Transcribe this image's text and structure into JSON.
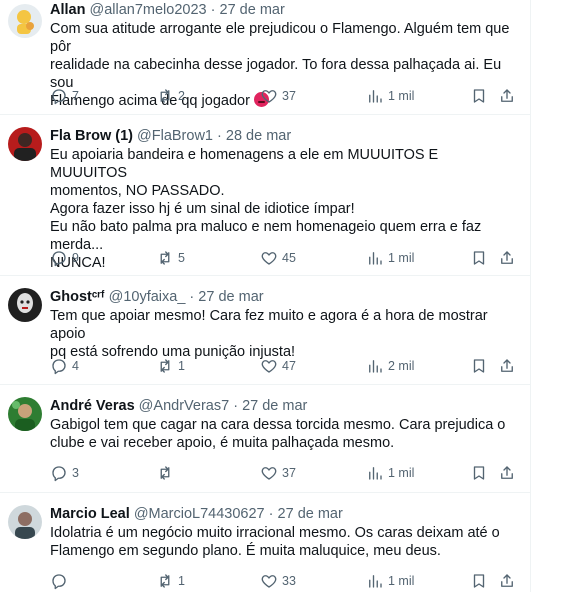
{
  "tweets": [
    {
      "name": "Allan",
      "handle": "@allan7melo2023",
      "sep": "·",
      "date": "27 de mar",
      "text": "Com sua atitude arrogante ele prejudicou o Flamengo. Alguém tem que pôr\nrealidade na cabecinha desse jogador. To fora dessa palhaçada ai. Eu sou\nFlamengo acima de qq jogador",
      "replies": "7",
      "retweets": "2",
      "likes": "37",
      "views": "1 mil",
      "avatar_color": "#e6ecf0"
    },
    {
      "name": "Fla Brow (1)",
      "handle": "@FlaBrow1",
      "sep": "·",
      "date": "28 de mar",
      "text": "Eu apoiaria bandeira e homenagens a ele em MUUUITOS E MUUUITOS\nmomentos, NO PASSADO.\nAgora fazer isso hj é um sinal de idiotice ímpar!\nEu não bato palma pra maluco e nem homenageio quem erra e faz merda...\nNUNCA!",
      "replies": "9",
      "retweets": "5",
      "likes": "45",
      "views": "1 mil",
      "avatar_color": "#b71c1c"
    },
    {
      "name": "Ghostᶜʳᶠ",
      "handle": "@10yfaixa_",
      "sep": "·",
      "date": "27 de mar",
      "text": "Tem que apoiar mesmo! Cara fez muito e agora é a hora de mostrar apoio\npq está sofrendo uma punição injusta!",
      "replies": "4",
      "retweets": "1",
      "likes": "47",
      "views": "2 mil",
      "avatar_color": "#202020"
    },
    {
      "name": "André Veras",
      "handle": "@AndrVeras7",
      "sep": "·",
      "date": "27 de mar",
      "text": "Gabigol tem que cagar na cara dessa torcida mesmo. Cara prejudica o\nclube e vai receber apoio, é muita palhaçada mesmo.",
      "replies": "3",
      "retweets": "",
      "likes": "37",
      "views": "1 mil",
      "avatar_color": "#2e7d32"
    },
    {
      "name": "Marcio Leal",
      "handle": "@MarcioL74430627",
      "sep": "·",
      "date": "27 de mar",
      "text": "Idolatria é um negócio muito irracional mesmo. Os caras deixam até o\nFlamengo em segundo plano. É muita maluquice, meu deus.",
      "replies": "",
      "retweets": "1",
      "likes": "33",
      "views": "1 mil",
      "avatar_color": "#8d6e63"
    }
  ]
}
